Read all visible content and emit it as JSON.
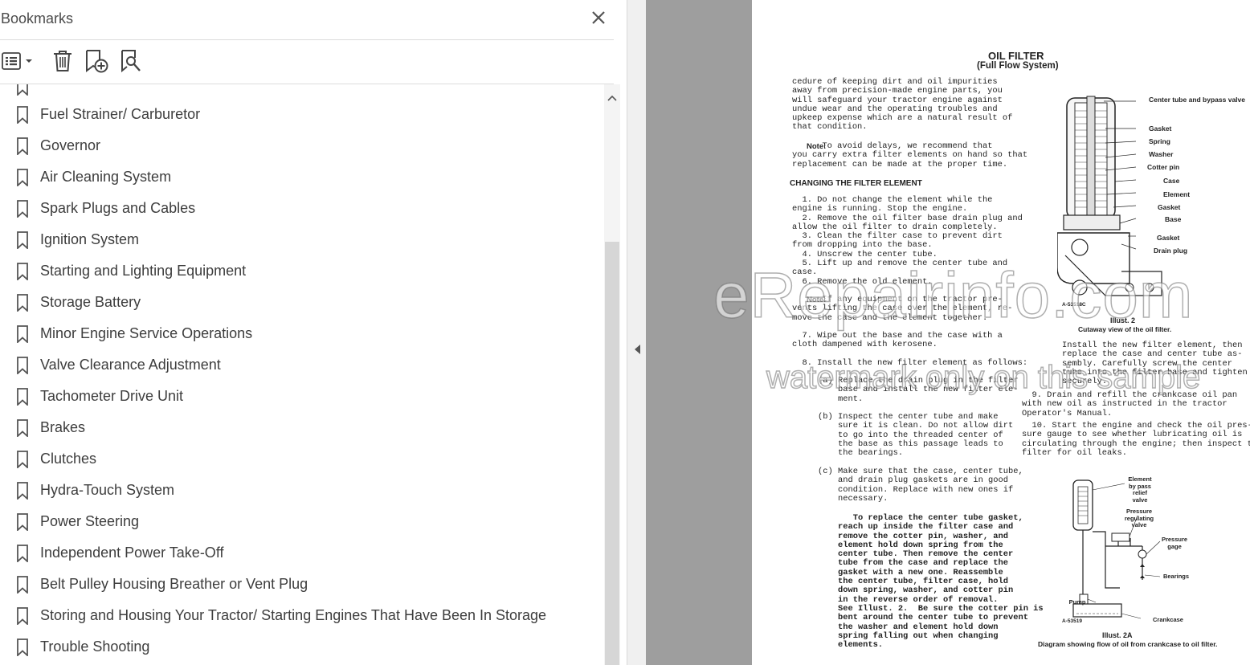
{
  "bookmarks_panel": {
    "title": "Bookmarks",
    "items": [
      {
        "label": "Fuel Strainer/ Carburetor"
      },
      {
        "label": "Governor"
      },
      {
        "label": "Air Cleaning System"
      },
      {
        "label": "Spark Plugs and Cables"
      },
      {
        "label": "Ignition System"
      },
      {
        "label": "Starting and Lighting Equipment"
      },
      {
        "label": "Storage Battery"
      },
      {
        "label": "Minor Engine Service Operations"
      },
      {
        "label": "Valve Clearance Adjustment"
      },
      {
        "label": "Tachometer Drive Unit"
      },
      {
        "label": "Brakes"
      },
      {
        "label": "Clutches"
      },
      {
        "label": "Hydra-Touch System"
      },
      {
        "label": "Power Steering"
      },
      {
        "label": "Independent Power Take-Off"
      },
      {
        "label": "Belt Pulley Housing Breather or Vent Plug"
      },
      {
        "label": "Storing and Housing Your Tractor/ Starting Engines That Have Been In Storage"
      },
      {
        "label": "Trouble Shooting"
      }
    ]
  },
  "toolbar": {
    "icons": [
      "options-menu-icon",
      "delete-icon",
      "new-bookmark-icon",
      "find-bookmark-icon"
    ]
  },
  "document": {
    "title": "OIL FILTER",
    "subtitle": "(Full Flow System)",
    "left_col_1": "cedure of keeping dirt and oil impurities\naway from precision-made engine parts, you\nwill safeguard your tractor engine against\nundue wear and the operating troubles and\nupkeep expense which are a natural result of\nthat condition.",
    "note1_label": "Note:",
    "note1": "  To avoid delays, we recommend that\nyou carry extra filter elements on hand so that\nreplacement can be made at the proper time.",
    "section_heading": "CHANGING THE FILTER ELEMENT",
    "steps": "  1. Do not change the element while the\nengine is running. Stop the engine.\n  2. Remove the oil filter base drain plug and\nallow the oil filter to drain completely.\n  3. Clean the filter case to prevent dirt\nfrom dropping into the base.\n  4. Unscrew the center tube.\n  5. Lift up and remove the center tube and\ncase.\n  6. Remove the old element.",
    "note2_label": "Note:",
    "note2": " If any equipment on the tractor pre-\nvents lifting the case over the element, re-\nmove the case and the element together.",
    "step7": "  7. Wipe out the base and the case with a\ncloth dampened with kerosene.",
    "step8": "  8. Install the new filter element as follows:",
    "sub_a_label": "(a)",
    "sub_a": "Replace the drain plug in the filter\nbase and install the new filter ele-\nment.",
    "sub_b_label": "(b)",
    "sub_b": "Inspect the center tube and make\nsure it is clean. Do not allow dirt\nto go into the threaded center of\nthe base as this passage leads to\nthe bearings.",
    "sub_c_label": "(c)",
    "sub_c": "Make sure that the case, center tube,\nand drain plug gaskets are in good\ncondition. Replace with new ones if\nnecessary.",
    "gasket_para": "   To replace the center tube gasket,\nreach up inside the filter case and\nremove the cotter pin, washer, and\nelement hold down spring from the\ncenter tube. Then remove the center\ntube from the case and replace the\ngasket with a new one. Reassemble\nthe center tube, filter case, hold\ndown spring, washer, and cotter pin\nin the reverse order of removal.\nSee Illust. 2.  Be sure the cotter pin is\nbent around the center tube to prevent\nthe washer and element hold down\nspring falling out when changing\nelements.",
    "right_col_1": "Install the new filter element, then\nreplace the case and center tube as-\nsembly. Carefully screw the center\ntube into the filter base and tighten\nsecurely.",
    "step9": "  9. Drain and refill the crankcase oil pan\nwith new oil as instructed in the tractor\nOperator's Manual.",
    "step10": "  10. Start the engine and check the oil pres-\nsure gauge to see whether lubricating oil is\ncirculating through the engine; then inspect the\nfilter for oil leaks.",
    "illust2_title": "Illust. 2",
    "illust2_caption": "Cutaway view of the oil filter.",
    "illust2_code": "A-53518C",
    "illust2_labels": [
      "Center tube\nand bypass\nvalve",
      "Gasket",
      "Spring",
      "Washer",
      "Cotter pin",
      "Case",
      "Element",
      "Gasket",
      "Base",
      "Gasket",
      "Drain plug"
    ],
    "illust2a_title": "Illust. 2A",
    "illust2a_caption": "Diagram showing flow of oil from crankcase to oil filter.",
    "illust2a_code": "A-53519",
    "illust2a_labels": {
      "element": "Element\nby pass\nrelief\nvalve",
      "pressure_reg": "Pressure\nregulating\nvalve",
      "gage": "Pressure\ngage",
      "bearings": "Bearings",
      "pump": "Pump",
      "crankcase": "Crankcase"
    },
    "watermark_1": "eRepairinfo.com",
    "watermark_2": "watermark only on this sample"
  }
}
